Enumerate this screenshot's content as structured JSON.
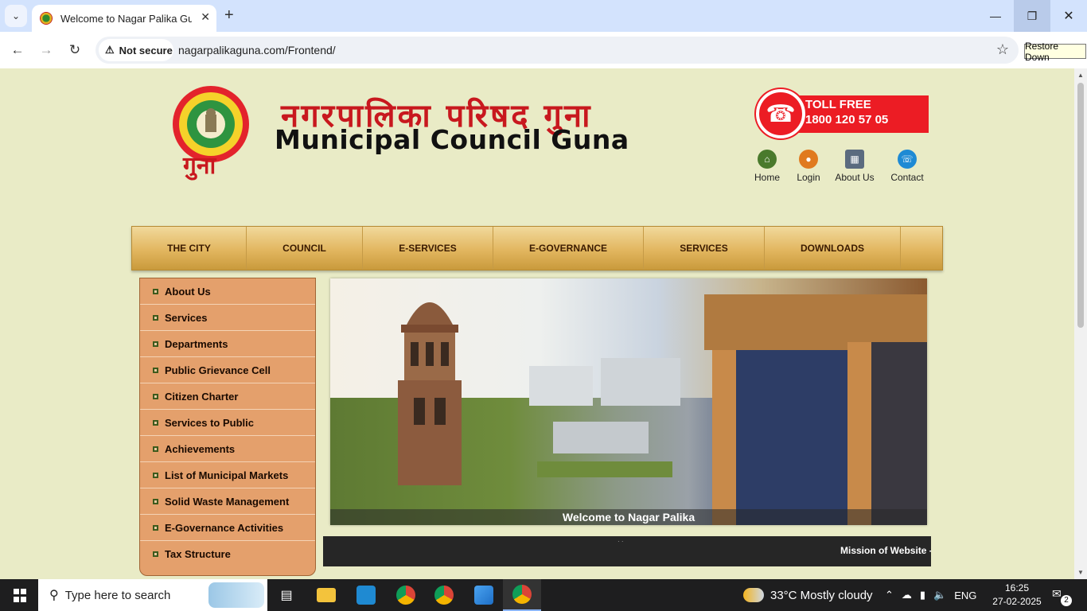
{
  "browser": {
    "tab_title": "Welcome to Nagar Palika Guna",
    "security_label": "Not secure",
    "url": "nagarpalikaguna.com/Frontend/",
    "tooltip": "Restore Down"
  },
  "header": {
    "hindi_title": "नगरपालिका परिषद गुना",
    "english_title": "Municipal Council Guna",
    "city_hindi": "गुना",
    "toll_free_label": "TOLL FREE",
    "toll_free_number": "1800 120 57 05",
    "quick_links": [
      "Home",
      "Login",
      "About Us",
      "Contact"
    ]
  },
  "menu": [
    "THE CITY",
    "COUNCIL",
    "E-SERVICES",
    "E-GOVERNANCE",
    "SERVICES",
    "DOWNLOADS"
  ],
  "sidebar": [
    "About Us",
    "Services",
    "Departments",
    "Public Grievance Cell",
    "Citizen Charter",
    "Services to Public",
    "Achievements",
    "List of Municipal Markets",
    "Solid Waste Management",
    "E-Governance Activities",
    "Tax Structure"
  ],
  "banner": {
    "caption": "Welcome to Nagar Palika"
  },
  "marquee": {
    "text": "Mission of Website - T"
  },
  "taskbar": {
    "search_placeholder": "Type here to search",
    "weather": "33°C  Mostly cloudy",
    "language": "ENG",
    "time": "16:25",
    "date": "27-02-2025",
    "notification_count": "2"
  }
}
